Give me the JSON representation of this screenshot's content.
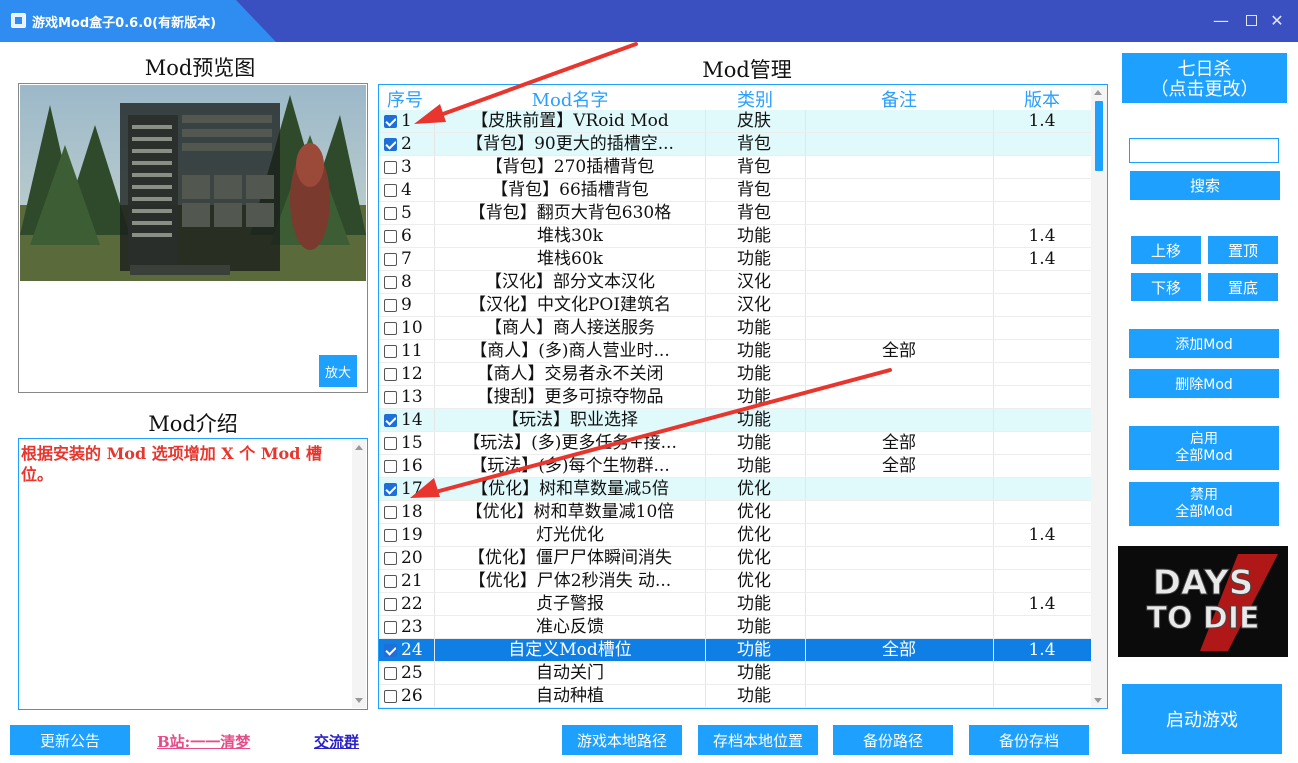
{
  "window": {
    "title": "游戏Mod盒子0.6.0(有新版本)",
    "controls": {
      "minimize": "—",
      "close": "✕"
    }
  },
  "preview": {
    "title": "Mod预览图",
    "zoom_label": "放大"
  },
  "intro": {
    "title": "Mod介绍",
    "text": "根据安装的 Mod 选项增加 X 个 Mod 槽位。"
  },
  "list": {
    "title": "Mod管理",
    "columns": {
      "num": "序号",
      "name": "Mod名字",
      "type": "类别",
      "note": "备注",
      "version": "版本"
    },
    "rows": [
      {
        "num": "1",
        "name": "【皮肤前置】VRoid Mod",
        "type": "皮肤",
        "note": "",
        "version": "1.4",
        "checked": true,
        "selected": false
      },
      {
        "num": "2",
        "name": "【背包】90更大的插槽空...",
        "type": "背包",
        "note": "",
        "version": "",
        "checked": true,
        "selected": false
      },
      {
        "num": "3",
        "name": "【背包】270插槽背包",
        "type": "背包",
        "note": "",
        "version": "",
        "checked": false,
        "selected": false
      },
      {
        "num": "4",
        "name": "【背包】66插槽背包",
        "type": "背包",
        "note": "",
        "version": "",
        "checked": false,
        "selected": false
      },
      {
        "num": "5",
        "name": "【背包】翻页大背包630格",
        "type": "背包",
        "note": "",
        "version": "",
        "checked": false,
        "selected": false
      },
      {
        "num": "6",
        "name": "堆栈30k",
        "type": "功能",
        "note": "",
        "version": "1.4",
        "checked": false,
        "selected": false
      },
      {
        "num": "7",
        "name": "堆栈60k",
        "type": "功能",
        "note": "",
        "version": "1.4",
        "checked": false,
        "selected": false
      },
      {
        "num": "8",
        "name": "【汉化】部分文本汉化",
        "type": "汉化",
        "note": "",
        "version": "",
        "checked": false,
        "selected": false
      },
      {
        "num": "9",
        "name": "【汉化】中文化POI建筑名",
        "type": "汉化",
        "note": "",
        "version": "",
        "checked": false,
        "selected": false
      },
      {
        "num": "10",
        "name": "【商人】商人接送服务",
        "type": "功能",
        "note": "",
        "version": "",
        "checked": false,
        "selected": false
      },
      {
        "num": "11",
        "name": "【商人】(多)商人营业时...",
        "type": "功能",
        "note": "全部",
        "version": "",
        "checked": false,
        "selected": false
      },
      {
        "num": "12",
        "name": "【商人】交易者永不关闭",
        "type": "功能",
        "note": "",
        "version": "",
        "checked": false,
        "selected": false
      },
      {
        "num": "13",
        "name": "【搜刮】更多可掠夺物品",
        "type": "功能",
        "note": "",
        "version": "",
        "checked": false,
        "selected": false
      },
      {
        "num": "14",
        "name": "【玩法】职业选择",
        "type": "功能",
        "note": "",
        "version": "",
        "checked": true,
        "selected": false
      },
      {
        "num": "15",
        "name": "【玩法】(多)更多任务+接...",
        "type": "功能",
        "note": "全部",
        "version": "",
        "checked": false,
        "selected": false
      },
      {
        "num": "16",
        "name": "【玩法】(多)每个生物群...",
        "type": "功能",
        "note": "全部",
        "version": "",
        "checked": false,
        "selected": false
      },
      {
        "num": "17",
        "name": "【优化】树和草数量减5倍",
        "type": "优化",
        "note": "",
        "version": "",
        "checked": true,
        "selected": false
      },
      {
        "num": "18",
        "name": "【优化】树和草数量减10倍",
        "type": "优化",
        "note": "",
        "version": "",
        "checked": false,
        "selected": false
      },
      {
        "num": "19",
        "name": "灯光优化",
        "type": "优化",
        "note": "",
        "version": "1.4",
        "checked": false,
        "selected": false
      },
      {
        "num": "20",
        "name": "【优化】僵尸尸体瞬间消失",
        "type": "优化",
        "note": "",
        "version": "",
        "checked": false,
        "selected": false
      },
      {
        "num": "21",
        "name": "【优化】尸体2秒消失 动...",
        "type": "优化",
        "note": "",
        "version": "",
        "checked": false,
        "selected": false
      },
      {
        "num": "22",
        "name": "贞子警报",
        "type": "功能",
        "note": "",
        "version": "1.4",
        "checked": false,
        "selected": false
      },
      {
        "num": "23",
        "name": "准心反馈",
        "type": "功能",
        "note": "",
        "version": "",
        "checked": false,
        "selected": false
      },
      {
        "num": "24",
        "name": "自定义Mod槽位",
        "type": "功能",
        "note": "全部",
        "version": "1.4",
        "checked": true,
        "selected": true
      },
      {
        "num": "25",
        "name": "自动关门",
        "type": "功能",
        "note": "",
        "version": "",
        "checked": false,
        "selected": false
      },
      {
        "num": "26",
        "name": "自动种植",
        "type": "功能",
        "note": "",
        "version": "",
        "checked": false,
        "selected": false
      }
    ]
  },
  "side": {
    "game_line1": "七日杀",
    "game_line2": "（点击更改）",
    "search_value": "",
    "search_label": "搜索",
    "move_up": "上移",
    "move_top": "置顶",
    "move_down": "下移",
    "move_bottom": "置底",
    "add_mod": "添加Mod",
    "delete_mod": "删除Mod",
    "enable_all_1": "启用",
    "enable_all_2": "全部Mod",
    "disable_all_1": "禁用",
    "disable_all_2": "全部Mod",
    "launch": "启动游戏"
  },
  "bottom": {
    "update_notice": "更新公告",
    "bilibili_link": "B站:一一清梦",
    "group_link": "交流群",
    "game_path": "游戏本地路径",
    "save_path": "存档本地位置",
    "backup_path": "备份路径",
    "backup_save": "备份存档"
  },
  "colors": {
    "titlebar": "#3a4fc0",
    "tab": "#2f8cf0",
    "accent": "#1ea0ff",
    "checked_row": "#e0f9fb",
    "selected_row": "#0f7fe6",
    "intro_text": "#e8352d",
    "annotation_arrow": "#e8352d",
    "bilibili_link": "#e84c88",
    "group_link": "#2a22c8"
  },
  "icons": {
    "zoom": "none",
    "logo": "7-days-to-die-logo"
  }
}
